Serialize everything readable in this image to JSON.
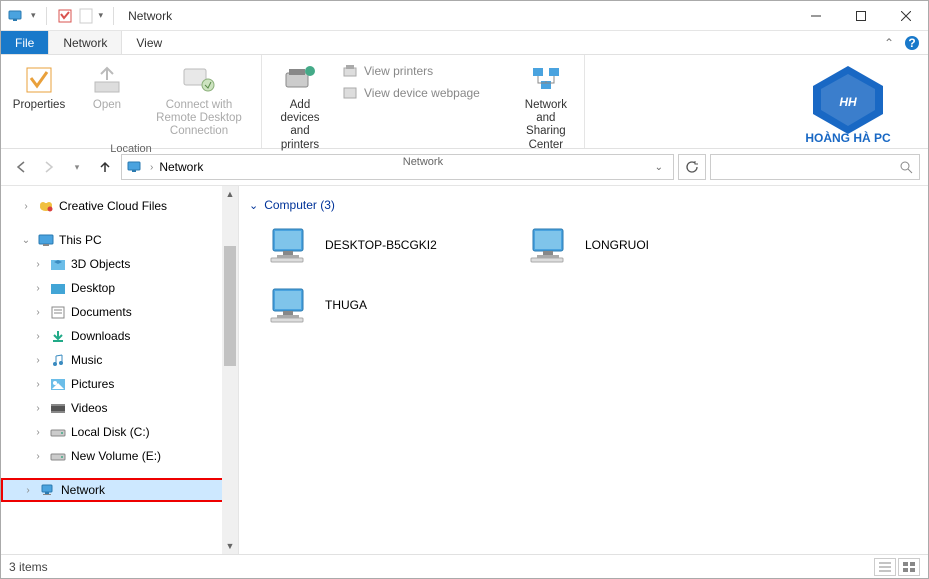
{
  "window": {
    "title": "Network"
  },
  "tabs": {
    "file": "File",
    "network": "Network",
    "view": "View"
  },
  "ribbon": {
    "location": {
      "label": "Location",
      "properties": "Properties",
      "open": "Open",
      "connect_rdp": "Connect with Remote Desktop Connection"
    },
    "network_group": {
      "label": "Network",
      "add_devices": "Add devices and printers",
      "view_printers": "View printers",
      "view_device_webpage": "View device webpage",
      "nsc": "Network and Sharing Center"
    },
    "logo_text": "HOÀNG HÀ PC"
  },
  "addressbar": {
    "crumb1": "Network"
  },
  "search": {
    "placeholder": ""
  },
  "tree": {
    "items": [
      {
        "label": "Creative Cloud Files",
        "indent": 1,
        "expander": ">",
        "icon": "cloud"
      },
      {
        "label": "This PC",
        "indent": 1,
        "expander": "v",
        "icon": "pc",
        "expanded": true
      },
      {
        "label": "3D Objects",
        "indent": 2,
        "expander": ">",
        "icon": "folder-3d"
      },
      {
        "label": "Desktop",
        "indent": 2,
        "expander": ">",
        "icon": "folder-desktop"
      },
      {
        "label": "Documents",
        "indent": 2,
        "expander": ">",
        "icon": "folder-docs"
      },
      {
        "label": "Downloads",
        "indent": 2,
        "expander": ">",
        "icon": "folder-dl"
      },
      {
        "label": "Music",
        "indent": 2,
        "expander": ">",
        "icon": "folder-music"
      },
      {
        "label": "Pictures",
        "indent": 2,
        "expander": ">",
        "icon": "folder-pics"
      },
      {
        "label": "Videos",
        "indent": 2,
        "expander": ">",
        "icon": "folder-vids"
      },
      {
        "label": "Local Disk (C:)",
        "indent": 2,
        "expander": ">",
        "icon": "drive"
      },
      {
        "label": "New Volume (E:)",
        "indent": 2,
        "expander": ">",
        "icon": "drive"
      },
      {
        "label": "Network",
        "indent": 1,
        "expander": ">",
        "icon": "network",
        "selected": true
      }
    ]
  },
  "content": {
    "group_header": "Computer (3)",
    "computers": [
      {
        "name": "DESKTOP-B5CGKI2"
      },
      {
        "name": "LONGRUOI"
      },
      {
        "name": "THUGA"
      }
    ]
  },
  "statusbar": {
    "text": "3 items"
  }
}
